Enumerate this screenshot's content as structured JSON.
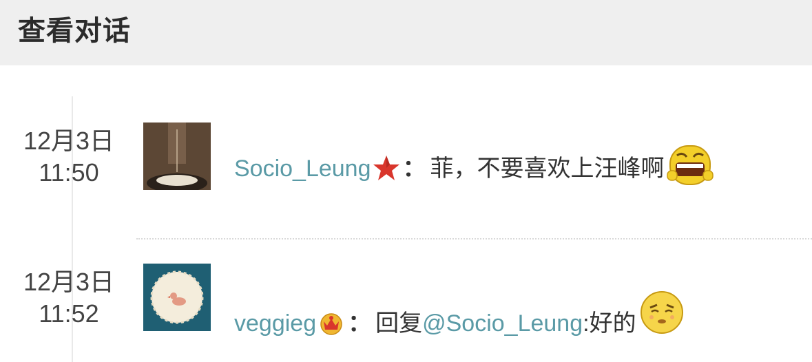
{
  "header": {
    "title": "查看对话"
  },
  "conversation": [
    {
      "date": "12月3日",
      "time": "11:50",
      "username": "Socio_Leung",
      "badge_icon": "red-star-badge-icon",
      "colon": "：",
      "text": "菲，不要喜欢上汪峰啊",
      "emoji_icon": "crying-yelling-face-icon"
    },
    {
      "date": "12月3日",
      "time": "11:52",
      "username": "veggieg",
      "badge_icon": "crown-badge-icon",
      "colon": "：",
      "reply_prefix": "回复",
      "mention": "@Socio_Leung",
      "text": ":好的",
      "emoji_icon": "sad-worried-face-icon"
    }
  ],
  "colors": {
    "header_bg": "#efefef",
    "link": "#5a9aa6",
    "text": "#333333"
  }
}
